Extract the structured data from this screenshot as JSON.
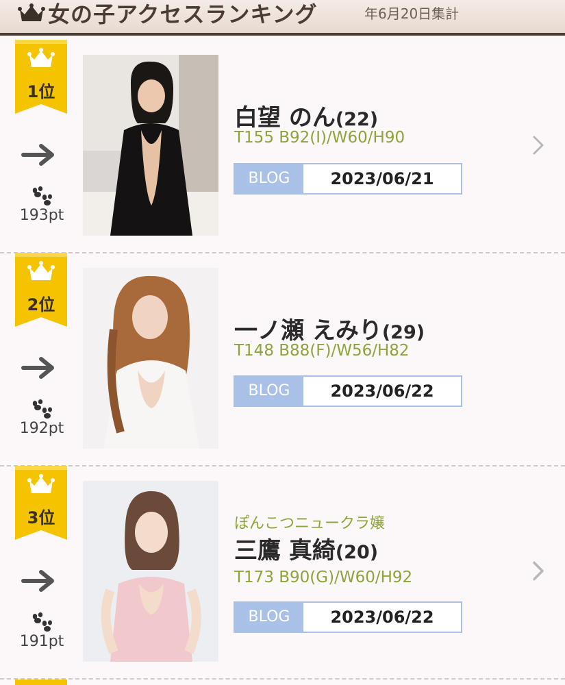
{
  "header": {
    "title": "女の子アクセスランキング",
    "date": "年6月20日集計",
    "crown_icon": "crown-icon"
  },
  "colors": {
    "accent_green": "#8ea43a",
    "badge_gold": "#f5c400",
    "blog_blue": "#a9c1e6",
    "header_brown": "#4a3c34"
  },
  "blog_label": "BLOG",
  "entries": [
    {
      "rank": "1位",
      "trend": "arrow-right-icon",
      "points": "193pt",
      "tagline": "",
      "name": "白望 のん",
      "age": "(22)",
      "stats": "T155 B92(I)/W60/H90",
      "blog_date": "2023/06/21"
    },
    {
      "rank": "2位",
      "trend": "arrow-right-icon",
      "points": "192pt",
      "tagline": "",
      "name": "一ノ瀬 えみり",
      "age": "(29)",
      "stats": "T148 B88(F)/W56/H82",
      "blog_date": "2023/06/22"
    },
    {
      "rank": "3位",
      "trend": "arrow-right-icon",
      "points": "191pt",
      "tagline": "ぽんこつニュークラ嬢",
      "name": "三鷹 真綺",
      "age": "(20)",
      "stats": "T173 B90(G)/W60/H92",
      "blog_date": "2023/06/22"
    }
  ]
}
